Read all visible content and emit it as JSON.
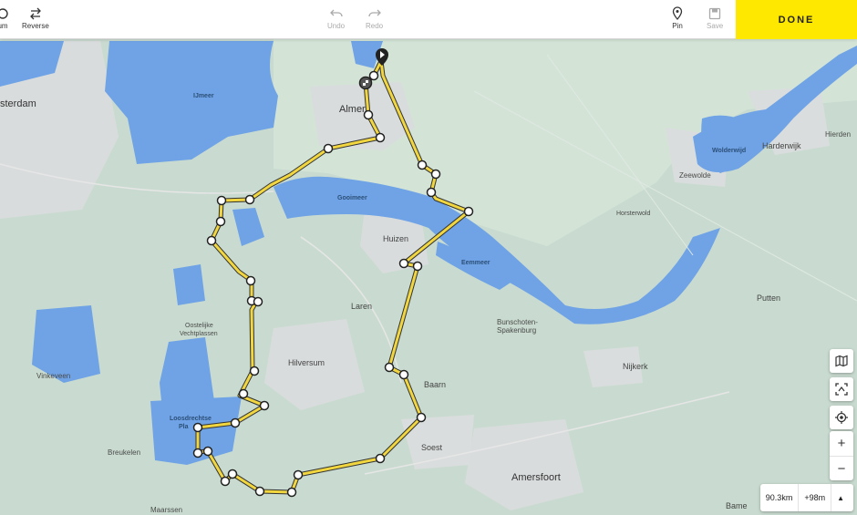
{
  "toolbar": {
    "zoom_label": "um",
    "reverse_label": "Reverse",
    "undo_label": "Undo",
    "redo_label": "Redo",
    "pin_label": "Pin",
    "save_label": "Save",
    "done_label": "DONE"
  },
  "map": {
    "water_labels": {
      "ijmeer": "IJmeer",
      "gooimeer": "Gooimeer",
      "eemmeer": "Eemmeer",
      "wolderwijd": "Wolderwijd",
      "loosdrechtse": "Loosdrechtse",
      "loosdrechtse2": "Pla",
      "vinkeveen": "Vinkeveen"
    },
    "place_labels": {
      "amsterdam": "sterdam",
      "almere": "Almer",
      "huizen": "Huizen",
      "laren": "Laren",
      "hilversum": "Hilversum",
      "baarn": "Baarn",
      "soest": "Soest",
      "amersfoort": "Amersfoort",
      "bunschoten": "Bunschoten-",
      "spakenburg": "Spakenburg",
      "nijkerk": "Nijkerk",
      "putten": "Putten",
      "harderwijk": "Harderwijk",
      "hierden": "Hierden",
      "zeewolde": "Zeewolde",
      "horsterwold": "Horsterwold",
      "breukelen": "Breukelen",
      "maarssen": "Maarssen",
      "oostelijke": "Oostelijke",
      "vechtplassen": "Vechtplassen",
      "bame": "Bame"
    }
  },
  "stats": {
    "distance": "90.3km",
    "elevation": "+98m"
  },
  "colors": {
    "accent": "#ffe800",
    "route": "#f1d640",
    "water": "#6fa3e6",
    "land": "#c8d9cf"
  }
}
